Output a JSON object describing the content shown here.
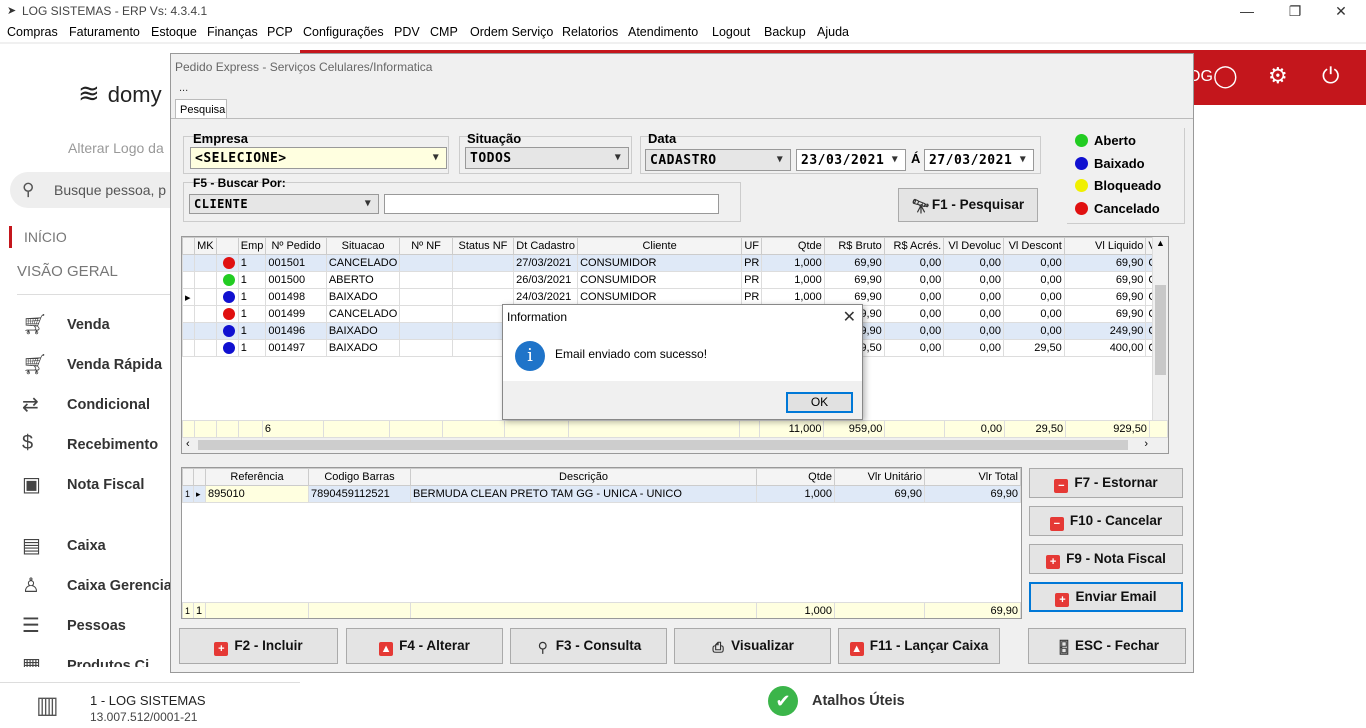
{
  "window": {
    "title": "LOG SISTEMAS - ERP Vs: 4.3.4.1",
    "minimize": "—",
    "maximize": "❐",
    "close": "✕"
  },
  "menu": [
    "Compras",
    "Faturamento",
    "Estoque",
    "Finanças",
    "PCP",
    "Configurações",
    "PDV",
    "CMP",
    "Ordem Serviço",
    "Relatorios",
    "Atendimento",
    "Logout",
    "Backup",
    "Ajuda"
  ],
  "sidebar": {
    "logo_text": "domy",
    "alter_logo": "Alterar Logo da",
    "search_placeholder": "Busque pessoa, p",
    "inicio": "INÍCIO",
    "visao_geral": "VISÃO GERAL",
    "items": [
      {
        "label": "Venda",
        "icon": "cart-icon"
      },
      {
        "label": "Venda Rápida",
        "icon": "cart-icon"
      },
      {
        "label": "Condicional",
        "icon": "cart-exchange-icon"
      },
      {
        "label": "Recebimento",
        "icon": "money-hand-icon"
      },
      {
        "label": "Nota Fiscal",
        "icon": "nfe-icon"
      },
      {
        "label": "Caixa",
        "icon": "cash-register-icon"
      },
      {
        "label": "Caixa Gerencia",
        "icon": "user-money-icon"
      },
      {
        "label": "Pessoas",
        "icon": "people-list-icon"
      },
      {
        "label": "Produtos Ci",
        "icon": "box-icon"
      }
    ],
    "company_name": "1 - LOG SISTEMAS",
    "company_cnpj": "13.007.512/0001-21"
  },
  "topbar": {
    "og_text": "OG"
  },
  "atalhos": "Atalhos Úteis",
  "pedido": {
    "title": "Pedido Express - Serviços Celulares/Informatica",
    "subtitle": "...",
    "tab": "Pesquisa",
    "empresa_label": "Empresa",
    "empresa_value": "<SELECIONE>",
    "situacao_label": "Situação",
    "situacao_value": "TODOS",
    "data_label": "Data",
    "data_type": "CADASTRO",
    "data_from": "23/03/2021",
    "data_sep": "Á",
    "data_to": "27/03/2021",
    "buscar_label": "F5 - Buscar Por:",
    "buscar_value": "CLIENTE",
    "buscar_text": "",
    "pesquisar_btn": "F1 - Pesquisar",
    "legend": [
      {
        "label": "Aberto",
        "color": "#22cc22"
      },
      {
        "label": "Baixado",
        "color": "#1010d0"
      },
      {
        "label": "Bloqueado",
        "color": "#f0f000"
      },
      {
        "label": "Cancelado",
        "color": "#e01010"
      }
    ],
    "orders": {
      "columns": [
        "MK",
        "Emp",
        "Nº Pedido",
        "Situacao",
        "Nº NF",
        "Status NF",
        "Dt Cadastro",
        "Cliente",
        "UF",
        "Qtde",
        "R$ Bruto",
        "R$ Acrés.",
        "Vl Devoluc",
        "Vl Descont",
        "Vl Liquido",
        "Ver"
      ],
      "rows": [
        {
          "status": "#e01010",
          "emp": "1",
          "num": "001501",
          "sit": "CANCELADO",
          "nf": "",
          "snf": "",
          "dt": "27/03/2021",
          "cli": "CONSUMIDOR",
          "uf": "PR",
          "qt": "1,000",
          "bruto": "69,90",
          "acres": "0,00",
          "dev": "0,00",
          "desc": "0,00",
          "liq": "69,90",
          "ver": "CO"
        },
        {
          "status": "#22cc22",
          "emp": "1",
          "num": "001500",
          "sit": "ABERTO",
          "nf": "",
          "snf": "",
          "dt": "26/03/2021",
          "cli": "CONSUMIDOR",
          "uf": "PR",
          "qt": "1,000",
          "bruto": "69,90",
          "acres": "0,00",
          "dev": "0,00",
          "desc": "0,00",
          "liq": "69,90",
          "ver": "CO"
        },
        {
          "status": "#1010d0",
          "emp": "1",
          "num": "001498",
          "sit": "BAIXADO",
          "nf": "",
          "snf": "",
          "dt": "24/03/2021",
          "cli": "CONSUMIDOR",
          "uf": "PR",
          "qt": "1,000",
          "bruto": "69,90",
          "acres": "0,00",
          "dev": "0,00",
          "desc": "0,00",
          "liq": "69,90",
          "ver": "CO"
        },
        {
          "status": "#e01010",
          "emp": "1",
          "num": "001499",
          "sit": "CANCELADO",
          "nf": "",
          "snf": "",
          "dt": "",
          "cli": "",
          "uf": "",
          "qt": "",
          "bruto": "9,90",
          "acres": "0,00",
          "dev": "0,00",
          "desc": "0,00",
          "liq": "69,90",
          "ver": "CO"
        },
        {
          "status": "#1010d0",
          "emp": "1",
          "num": "001496",
          "sit": "BAIXADO",
          "nf": "",
          "snf": "",
          "dt": "",
          "cli": "",
          "uf": "",
          "qt": "",
          "bruto": "9,90",
          "acres": "0,00",
          "dev": "0,00",
          "desc": "0,00",
          "liq": "249,90",
          "ver": "CO"
        },
        {
          "status": "#1010d0",
          "emp": "1",
          "num": "001497",
          "sit": "BAIXADO",
          "nf": "",
          "snf": "",
          "dt": "",
          "cli": "",
          "uf": "",
          "qt": "",
          "bruto": "9,50",
          "acres": "0,00",
          "dev": "0,00",
          "desc": "29,50",
          "liq": "400,00",
          "ver": "CO"
        }
      ],
      "totals": {
        "count": "6",
        "qt": "11,000",
        "bruto": "959,00",
        "dev": "0,00",
        "desc": "29,50",
        "liq": "929,50"
      }
    },
    "items": {
      "columns": [
        "Referência",
        "Codigo Barras",
        "Descrição",
        "Qtde",
        "Vlr Unitário",
        "Vlr Total"
      ],
      "rows": [
        {
          "idx": "1",
          "ref": "895010",
          "cod": "7890459112521",
          "desc": "BERMUDA CLEAN PRETO TAM  GG - UNICA - UNICO",
          "qt": "1,000",
          "unit": "69,90",
          "total": "69,90"
        }
      ],
      "totals": {
        "idx": "1",
        "ref": "1",
        "qt": "1,000",
        "total": "69,90"
      }
    },
    "side_buttons": [
      "F7 - Estornar",
      "F10 - Cancelar",
      "F9 - Nota Fiscal",
      "Enviar Email"
    ],
    "bottom_buttons": [
      "F2 - Incluir",
      "F4 - Alterar",
      "F3 - Consulta",
      "Visualizar",
      "F11 - Lançar Caixa",
      "ESC - Fechar"
    ]
  },
  "msgbox": {
    "title": "Information",
    "text": "Email enviado com sucesso!",
    "ok": "OK",
    "icon_letter": "i"
  }
}
